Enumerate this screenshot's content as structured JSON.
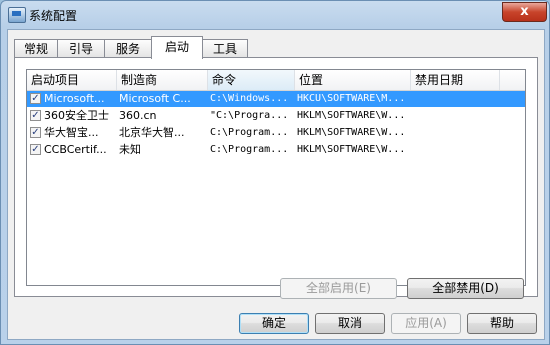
{
  "window": {
    "title": "系统配置",
    "close_glyph": "x"
  },
  "tabs": [
    "常规",
    "引导",
    "服务",
    "启动",
    "工具"
  ],
  "active_tab": "启动",
  "table": {
    "columns": [
      "启动项目",
      "制造商",
      "命令",
      "位置",
      "禁用日期"
    ],
    "rows": [
      {
        "checked": true,
        "check_glyph": "✓",
        "item": "Microsoft...",
        "maker": "Microsoft C...",
        "command": "C:\\Windows...",
        "location": "HKCU\\SOFTWARE\\M...",
        "disabled_date": ""
      },
      {
        "checked": true,
        "check_glyph": "✓",
        "item": "360安全卫士",
        "maker": "360.cn",
        "command": "\"C:\\Progra...",
        "location": "HKLM\\SOFTWARE\\W...",
        "disabled_date": ""
      },
      {
        "checked": true,
        "check_glyph": "✓",
        "item": "华大智宝...",
        "maker": "北京华大智...",
        "command": "C:\\Program...",
        "location": "HKLM\\SOFTWARE\\W...",
        "disabled_date": ""
      },
      {
        "checked": true,
        "check_glyph": "✓",
        "item": "CCBCertif...",
        "maker": "未知",
        "command": "C:\\Program...",
        "location": "HKLM\\SOFTWARE\\W...",
        "disabled_date": ""
      }
    ]
  },
  "panel_buttons": {
    "enable_all": "全部启用(E)",
    "disable_all": "全部禁用(D)"
  },
  "dialog_buttons": {
    "ok": "确定",
    "cancel": "取消",
    "apply": "应用(A)",
    "help": "帮助"
  },
  "colors": {
    "selection": "#3399ff",
    "title_bg": "#b9d1ea",
    "close": "#c8442b"
  }
}
